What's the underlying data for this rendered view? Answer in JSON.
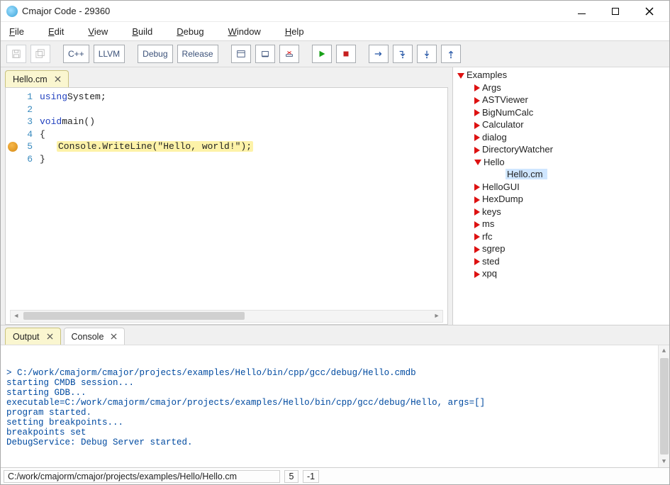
{
  "title": "Cmajor Code - 29360",
  "menu": {
    "file": "File",
    "edit": "Edit",
    "view": "View",
    "build": "Build",
    "debug": "Debug",
    "window": "Window",
    "help": "Help"
  },
  "toolbar": {
    "cpp": "C++",
    "llvm": "LLVM",
    "debug": "Debug",
    "release": "Release"
  },
  "editor": {
    "tab_label": "Hello.cm",
    "code": {
      "l1_kw": "using",
      "l1_rest": " System;",
      "l3_kw": "void",
      "l3_rest": " main()",
      "l4": "{",
      "l5": "Console.WriteLine(\"Hello, world!\");",
      "l6": "}"
    }
  },
  "tree": {
    "root": "Examples",
    "items": [
      "Args",
      "ASTViewer",
      "BigNumCalc",
      "Calculator",
      "dialog",
      "DirectoryWatcher"
    ],
    "hello": "Hello",
    "hello_file": "Hello.cm",
    "items_after": [
      "HelloGUI",
      "HexDump",
      "keys",
      "ms",
      "rfc",
      "sgrep",
      "sted",
      "xpq"
    ]
  },
  "bottom_tabs": {
    "output": "Output",
    "console": "Console"
  },
  "output_lines": [
    "> C:/work/cmajorm/cmajor/projects/examples/Hello/bin/cpp/gcc/debug/Hello.cmdb",
    "starting CMDB session...",
    "starting GDB...",
    "executable=C:/work/cmajorm/cmajor/projects/examples/Hello/bin/cpp/gcc/debug/Hello, args=[]",
    "program started.",
    "setting breakpoints...",
    "breakpoints set",
    "DebugService: Debug Server started."
  ],
  "status": {
    "path": "C:/work/cmajorm/cmajor/projects/examples/Hello/Hello.cm",
    "line": "5",
    "col": "-1"
  }
}
